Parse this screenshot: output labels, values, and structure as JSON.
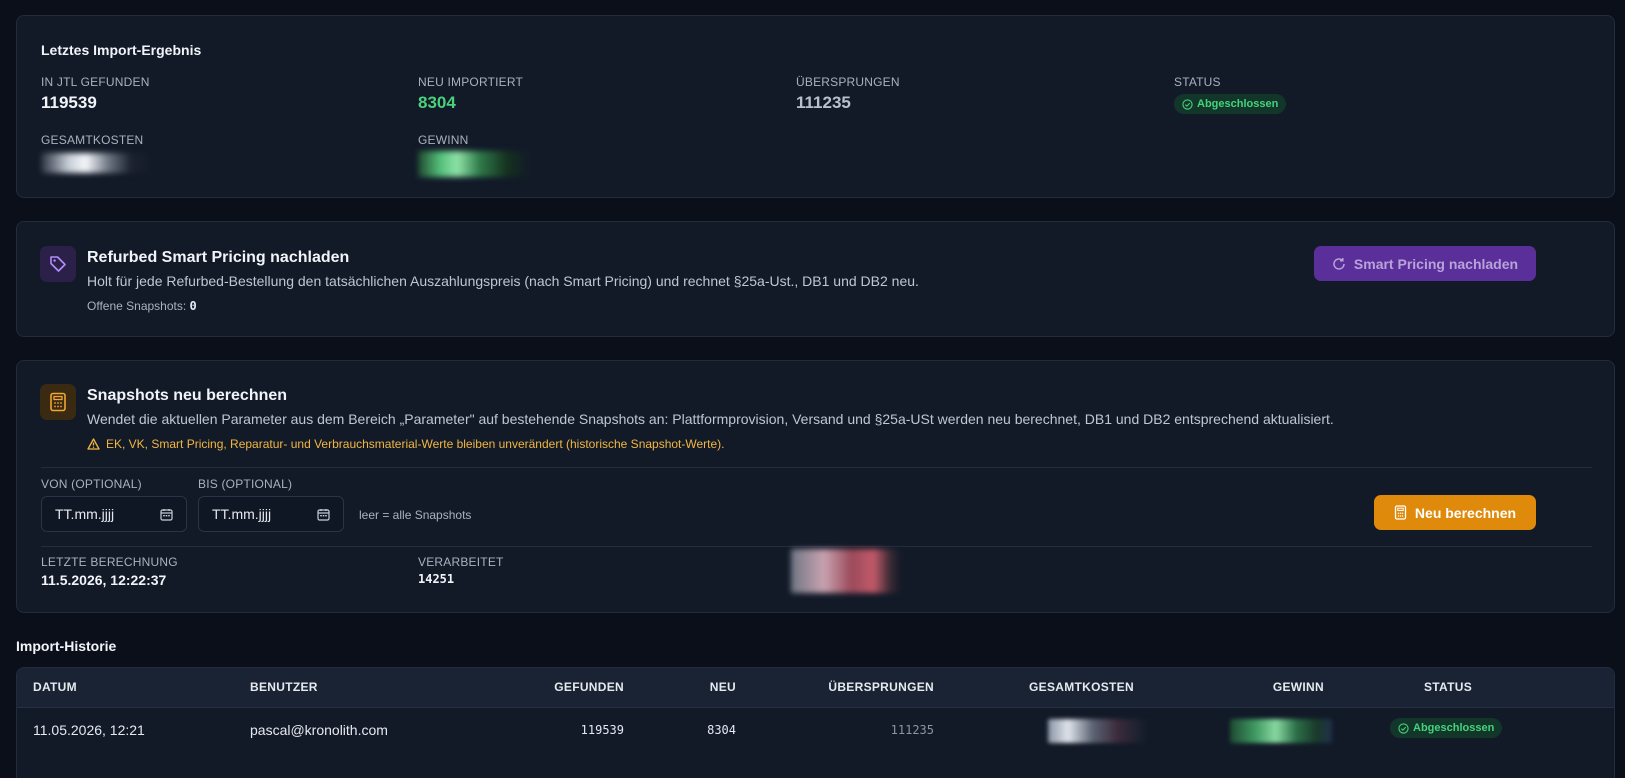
{
  "last_import": {
    "title": "Letztes Import-Ergebnis",
    "found_label": "IN JTL GEFUNDEN",
    "found_value": "119539",
    "imported_label": "NEU IMPORTIERT",
    "imported_value": "8304",
    "skipped_label": "ÜBERSPRUNGEN",
    "skipped_value": "111235",
    "status_label": "STATUS",
    "status_value": "Abgeschlossen",
    "costs_label": "GESAMTKOSTEN",
    "profit_label": "GEWINN"
  },
  "smart_pricing": {
    "title": "Refurbed Smart Pricing nachladen",
    "description": "Holt für jede Refurbed-Bestellung den tatsächlichen Auszahlungspreis (nach Smart Pricing) und rechnet §25a-Ust., DB1 und DB2 neu.",
    "open_label": "Offene Snapshots:",
    "open_value": "0",
    "button_label": "Smart Pricing nachladen"
  },
  "recalc": {
    "title": "Snapshots neu berechnen",
    "description": "Wendet die aktuellen Parameter aus dem Bereich „Parameter\" auf bestehende Snapshots an: Plattformprovision, Versand und §25a-USt werden neu berechnet, DB1 und DB2 entsprechend aktualisiert.",
    "warning": "EK, VK, Smart Pricing, Reparatur- und Verbrauchsmaterial-Werte bleiben unverändert (historische Snapshot-Werte).",
    "from_label": "VON (OPTIONAL)",
    "from_value": "TT.mm.jjjj",
    "to_label": "BIS (OPTIONAL)",
    "to_value": "TT.mm.jjjj",
    "hint": "leer = alle Snapshots",
    "button_label": "Neu berechnen",
    "last_calc_label": "LETZTE BERECHNUNG",
    "last_calc_value": "11.5.2026, 12:22:37",
    "processed_label": "VERARBEITET",
    "processed_value": "14251"
  },
  "history": {
    "title": "Import-Historie",
    "columns": [
      "DATUM",
      "BENUTZER",
      "GEFUNDEN",
      "NEU",
      "ÜBERSPRUNGEN",
      "GESAMTKOSTEN",
      "GEWINN",
      "STATUS"
    ],
    "rows": [
      {
        "date": "11.05.2026, 12:21",
        "user": "pascal@kronolith.com",
        "found": "119539",
        "new": "8304",
        "skipped": "111235",
        "status": "Abgeschlossen"
      }
    ]
  },
  "colors": {
    "accent_purple": "#6c3ab8",
    "accent_orange": "#e08a0b",
    "success": "#4ad17a",
    "warning": "#f2b640"
  }
}
